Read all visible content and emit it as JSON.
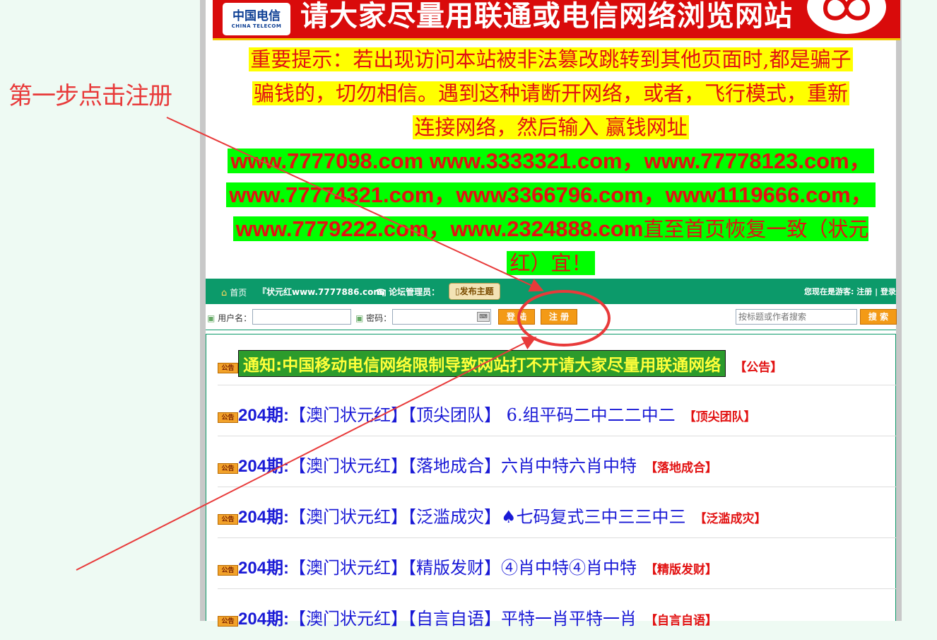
{
  "annotation": {
    "step_label": "第一步点击注册",
    "color": "#e83a3a"
  },
  "banner": {
    "logo_cn": "中国电信",
    "logo_en": "CHINA TELECOM",
    "text": "请大家尽量用联通或电信网络浏览网站"
  },
  "warning": {
    "line1": "重要提示：若出现访问本站被非法篡改跳转到其他页面时,都是骗子",
    "line2": "骗钱的，切勿相信。遇到这种请断开网络，或者，飞行模式，重新",
    "line3": "连接网络，然后输入 赢钱网址",
    "url_line1": "www.7777098.com www.3333321.com，www.77778123.com，",
    "url_line2": "www.77774321.com，www3366796.com，www1119666.com，",
    "url_line3_urls": "www.7779222.com，www.2324888.com",
    "url_line3_tail": "直至首页恢复一致（状元",
    "url_line4": "红）宜！"
  },
  "navbar": {
    "home": "首页",
    "forum_name": "『状元红www.7777886.com』",
    "admin_label": "论坛管理员：",
    "post_button": "发布主题",
    "guest_text": "您现在是游客:",
    "register_link": "注册",
    "separator": "|",
    "login_link": "登录"
  },
  "loginbar": {
    "username_label": "用户名：",
    "password_label": "密码：",
    "login_button": "登 陆",
    "register_button": "注 册",
    "search_placeholder": "按标题或作者搜索",
    "search_button": "搜 索"
  },
  "posts": [
    {
      "icon": "公告",
      "title": "通知:中国移动电信网络限制导致网站打不开请大家尽量用联通网络",
      "tag": "【公告】",
      "notice": true
    },
    {
      "icon": "公告",
      "num": "204期:",
      "title": "【澳门状元红】【顶尖团队】 6.组平码二中二二中二",
      "tag": "【顶尖团队】"
    },
    {
      "icon": "公告",
      "num": "204期:",
      "title": "【澳门状元红】【落地成合】六肖中特六肖中特",
      "tag": "【落地成合】"
    },
    {
      "icon": "公告",
      "num": "204期:",
      "title": "【澳门状元红】【泛滥成灾】♠七码复式三中三三中三",
      "tag": "【泛滥成灾】"
    },
    {
      "icon": "公告",
      "num": "204期:",
      "title": "【澳门状元红】【精版发财】④肖中特④肖中特",
      "tag": "【精版发财】"
    },
    {
      "icon": "公告",
      "num": "204期:",
      "title": "【澳门状元红】【自言自语】平特一肖平特一肖",
      "tag": "【自言自语】"
    }
  ]
}
